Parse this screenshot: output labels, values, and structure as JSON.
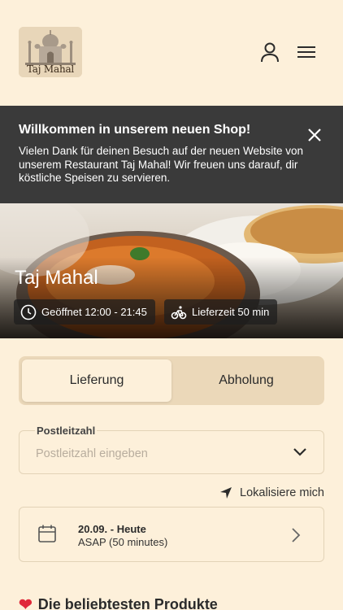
{
  "logo": {
    "text": "Taj Mahal"
  },
  "header": {
    "user_icon": "user-icon",
    "menu_icon": "hamburger-menu-icon"
  },
  "banner": {
    "title": "Willkommen in unserem neuen Shop!",
    "text": "Vielen Dank für deinen Besuch auf der neuen Website von unserem Restaurant Taj Mahal! Wir freuen uns darauf, dir köstliche Speisen zu servieren.",
    "close_icon": "close-icon",
    "background": "#3a3a3a"
  },
  "hero": {
    "title": "Taj Mahal",
    "opening": "Geöffnet 12:00 - 21:45",
    "delivery_time": "Lieferzeit 50 min"
  },
  "mode_toggle": {
    "options": [
      "Lieferung",
      "Abholung"
    ],
    "selected": "Lieferung"
  },
  "postcode": {
    "label": "Postleitzahl",
    "placeholder": "Postleitzahl eingeben",
    "value": ""
  },
  "locate": {
    "label": "Lokalisiere mich"
  },
  "schedule": {
    "date": "20.09. - Heute",
    "time": "ASAP (50 minutes)"
  },
  "popular": {
    "title": "Die beliebtesten Produkte",
    "icon": "heart-icon"
  },
  "colors": {
    "background": "#fdf0da",
    "accent": "#ebd8b9",
    "heart": "#e0293a"
  }
}
